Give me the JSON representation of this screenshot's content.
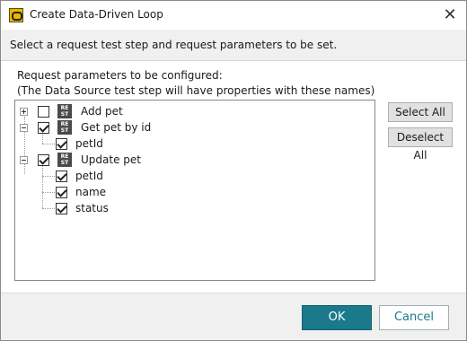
{
  "window": {
    "title": "Create Data-Driven Loop",
    "close_glyph": "✕"
  },
  "instruction": "Select a request test step and request parameters to be set.",
  "params_label_1": "Request parameters to be configured:",
  "params_label_2": "(The Data Source test step will have properties with these names)",
  "tree": {
    "add_pet": {
      "label": "Add pet",
      "icon_text_1": "RE",
      "icon_text_2": "ST",
      "checked": false,
      "expanded": false
    },
    "get_pet": {
      "label": "Get pet by id",
      "icon_text_1": "RE",
      "icon_text_2": "ST",
      "checked": true,
      "expanded": true
    },
    "get_pet_petid": {
      "label": "petId",
      "checked": true
    },
    "update_pet": {
      "label": "Update pet",
      "icon_text_1": "RE",
      "icon_text_2": "ST",
      "checked": true,
      "expanded": true
    },
    "update_pet_petid": {
      "label": "petId",
      "checked": true
    },
    "update_pet_name": {
      "label": "name",
      "checked": true
    },
    "update_pet_status": {
      "label": "status",
      "checked": true
    }
  },
  "buttons": {
    "select_all": "Select All",
    "deselect_all": "Deselect All",
    "ok": "OK",
    "cancel": "Cancel"
  },
  "colors": {
    "accent": "#1a7a8c",
    "footer_bg": "#f0f0f0"
  }
}
